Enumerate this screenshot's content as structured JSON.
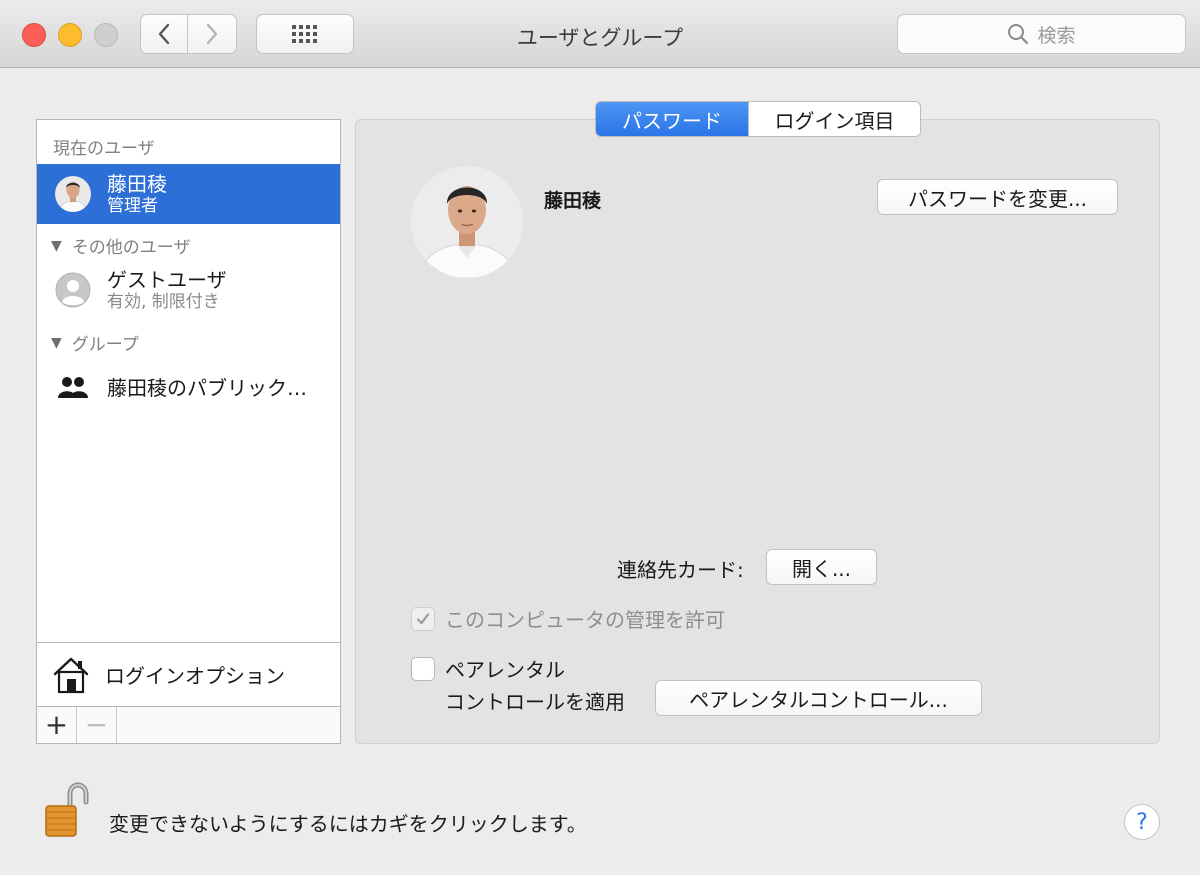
{
  "window": {
    "title": "ユーザとグループ"
  },
  "toolbar": {
    "search_placeholder": "検索",
    "back_icon": "chevron-left-icon",
    "forward_icon": "chevron-right-icon",
    "grid_icon": "grid-icon"
  },
  "sidebar": {
    "current_users_header": "現在のユーザ",
    "current_user": {
      "name": "藤田稜",
      "role": "管理者",
      "selected": true
    },
    "other_users_header": "その他のユーザ",
    "guest_user": {
      "name": "ゲストユーザ",
      "status": "有効, 制限付き"
    },
    "groups_header": "グループ",
    "group": {
      "name": "藤田稜のパブリック…"
    },
    "login_options_label": "ログインオプション",
    "add_label": "+",
    "remove_label": "−"
  },
  "tabs": [
    {
      "label": "パスワード",
      "active": true
    },
    {
      "label": "ログイン項目",
      "active": false
    }
  ],
  "main": {
    "user_name": "藤田稜",
    "change_password_button": "パスワードを変更...",
    "contact_card_label": "連絡先カード:",
    "open_button": "開く...",
    "allow_admin_label": "このコンピュータの管理を許可",
    "allow_admin_checked": true,
    "allow_admin_disabled": true,
    "parental_line1": "ペアレンタル",
    "parental_line2": "コントロールを適用",
    "parental_checked": false,
    "parental_button": "ペアレンタルコントロール..."
  },
  "footer": {
    "lock_text": "変更できないようにするにはカギをクリックします。",
    "help_label": "?"
  },
  "colors": {
    "selection": "#2c6fd6",
    "tab_active": "#2a75e8",
    "close": "#fc5f57",
    "minimize": "#fdbc2e",
    "zoom": "#cfcfcf"
  }
}
